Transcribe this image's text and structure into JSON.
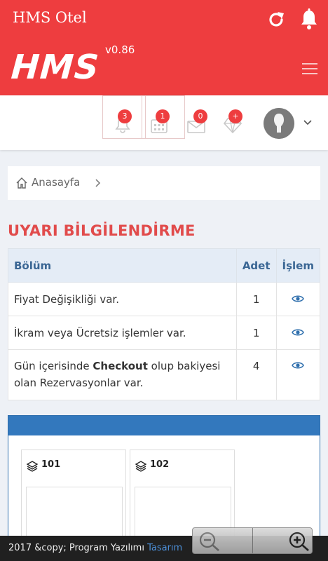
{
  "statusbar": {
    "title": "HMS Otel",
    "refresh_icon": "refresh-icon",
    "bell_icon": "bell-icon"
  },
  "brand": {
    "logo": "HMS",
    "version": "v0.86",
    "menu_icon": "hamburger-menu-icon"
  },
  "nav": {
    "items": [
      {
        "icon": "bell-icon",
        "badge": "3"
      },
      {
        "icon": "calendar-icon",
        "badge": "1"
      },
      {
        "icon": "envelope-icon",
        "badge": "0"
      },
      {
        "icon": "diamond-icon",
        "badge": "+"
      }
    ],
    "avatar_icon": "user-avatar",
    "dropdown_icon": "chevron-down-icon"
  },
  "breadcrumb": {
    "home": "Anasayfa"
  },
  "section_title": "UYARI BİLGİLENDİRME",
  "table": {
    "headers": {
      "section": "Bölüm",
      "count": "Adet",
      "action": "İşlem"
    },
    "rows": [
      {
        "label": "Fiyat Değişikliği var.",
        "count": "1"
      },
      {
        "label": "İkram veya Ücretsiz işlemler var.",
        "count": "1"
      },
      {
        "label_pre": "Gün içerisinde ",
        "label_bold": "Checkout",
        "label_post": " olup bakiyesi olan Rezervasyonlar var.",
        "count": "4"
      }
    ],
    "action_icon": "eye-icon"
  },
  "rooms": [
    {
      "number": "101"
    },
    {
      "number": "102"
    }
  ],
  "footer": {
    "text": "2017 &copy; Program Yazılımı ",
    "link": "Tasarım"
  },
  "colors": {
    "primary": "#ee3d3f",
    "header_blue": "#3378bd",
    "title_red": "#e14b4b"
  }
}
